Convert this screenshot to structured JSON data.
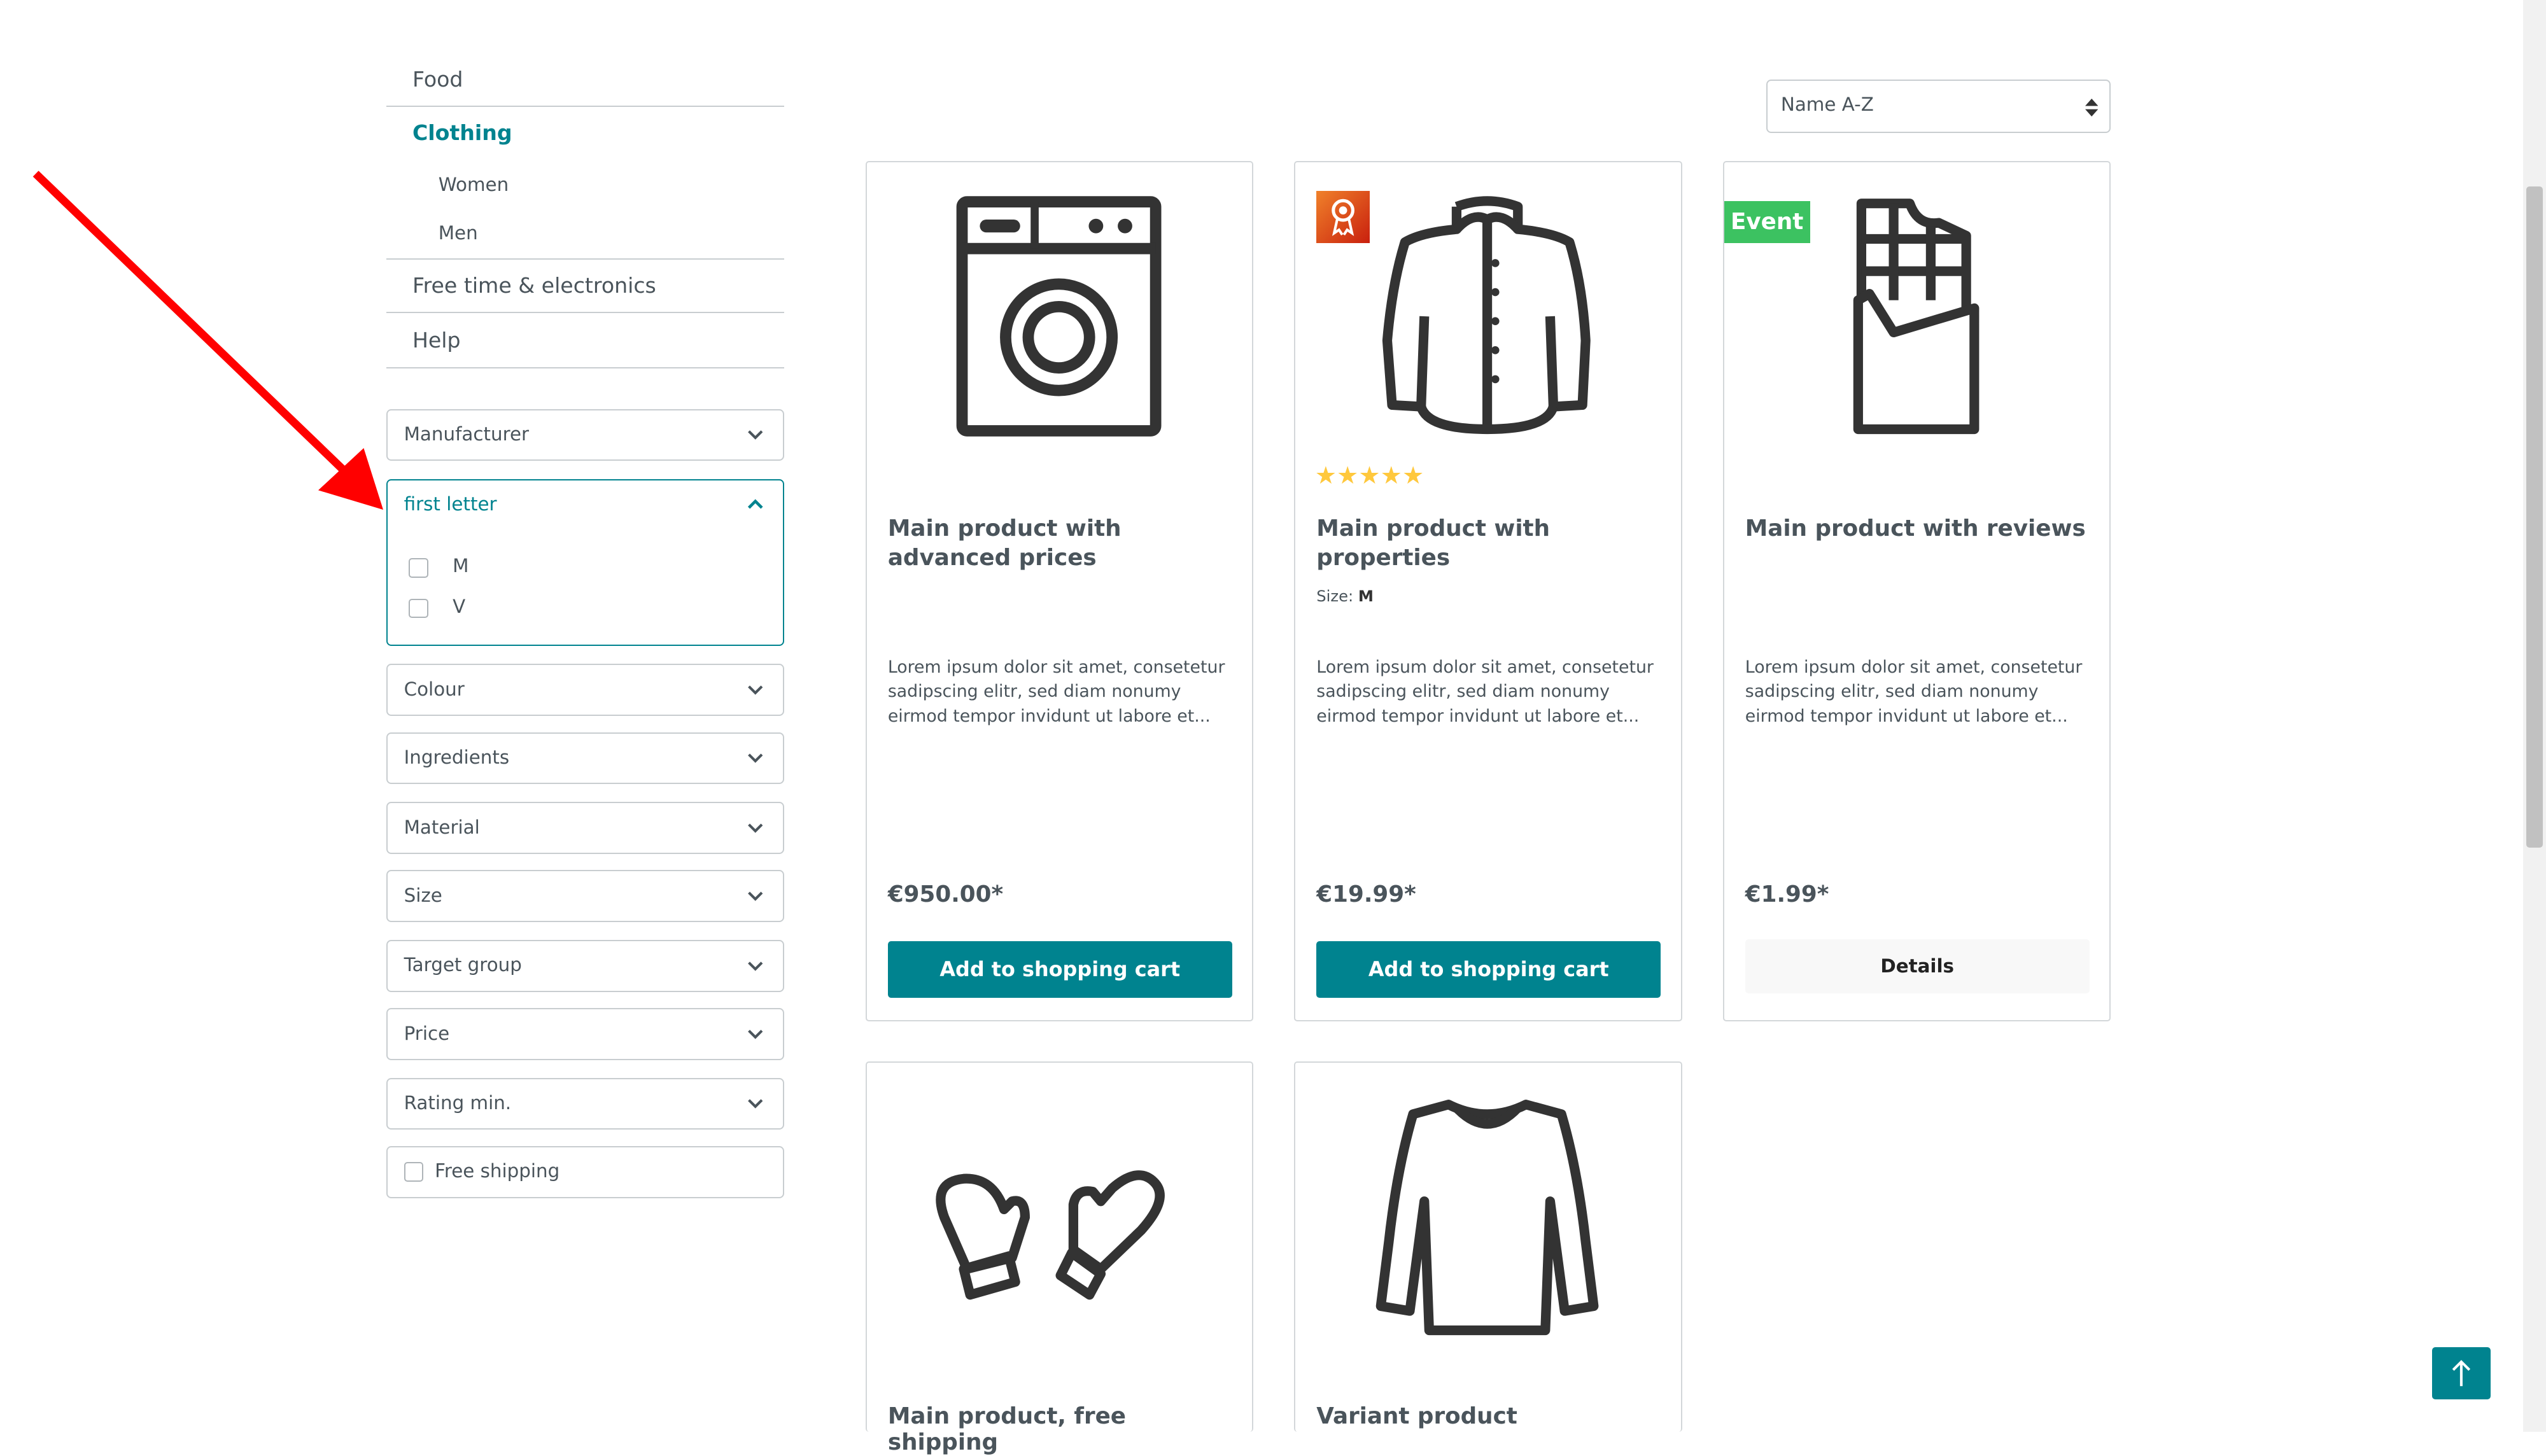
{
  "navigation": {
    "items": [
      {
        "label": "Food",
        "active": false
      },
      {
        "label": "Clothing",
        "active": true,
        "children": [
          {
            "label": "Women"
          },
          {
            "label": "Men"
          }
        ]
      },
      {
        "label": "Free time & electronics",
        "active": false
      },
      {
        "label": "Help",
        "active": false
      }
    ]
  },
  "filters": {
    "manufacturer": "Manufacturer",
    "first_letter": {
      "label": "first letter",
      "expanded": true,
      "options": [
        {
          "label": "M",
          "checked": false
        },
        {
          "label": "V",
          "checked": false
        }
      ]
    },
    "colour": "Colour",
    "ingredients": "Ingredients",
    "material": "Material",
    "size": "Size",
    "target_group": "Target group",
    "price": "Price",
    "rating": "Rating min.",
    "free_shipping": {
      "label": "Free shipping",
      "checked": false
    }
  },
  "sorting": {
    "selected": "Name A-Z"
  },
  "products": [
    {
      "title": "Main product with advanced prices",
      "description": "Lorem ipsum dolor sit amet, consetetur sadipscing elitr, sed diam nonumy eirmod tempor invidunt ut labore et...",
      "price": "€950.00*",
      "button": "Add to shopping cart",
      "icon": "washing-machine-icon"
    },
    {
      "title": "Main product with properties",
      "property_label": "Size:",
      "property_value": "M",
      "rating": 5,
      "badge_icon": "award-ribbon-icon",
      "description": "Lorem ipsum dolor sit amet, consetetur sadipscing elitr, sed diam nonumy eirmod tempor invidunt ut labore et...",
      "price": "€19.99*",
      "button": "Add to shopping cart",
      "icon": "jacket-icon"
    },
    {
      "title": "Main product with reviews",
      "badge": "Event",
      "description": "Lorem ipsum dolor sit amet, consetetur sadipscing elitr, sed diam nonumy eirmod tempor invidunt ut labore et...",
      "price": "€1.99*",
      "button": "Details",
      "icon": "chocolate-bar-icon"
    },
    {
      "title": "Main product, free shipping",
      "icon": "mittens-icon"
    },
    {
      "title": "Variant product",
      "icon": "sweater-icon"
    }
  ],
  "colors": {
    "accent": "#00838f",
    "event_badge": "#3cc261",
    "star": "#ffc83d",
    "annotation_arrow": "#ff0000"
  }
}
